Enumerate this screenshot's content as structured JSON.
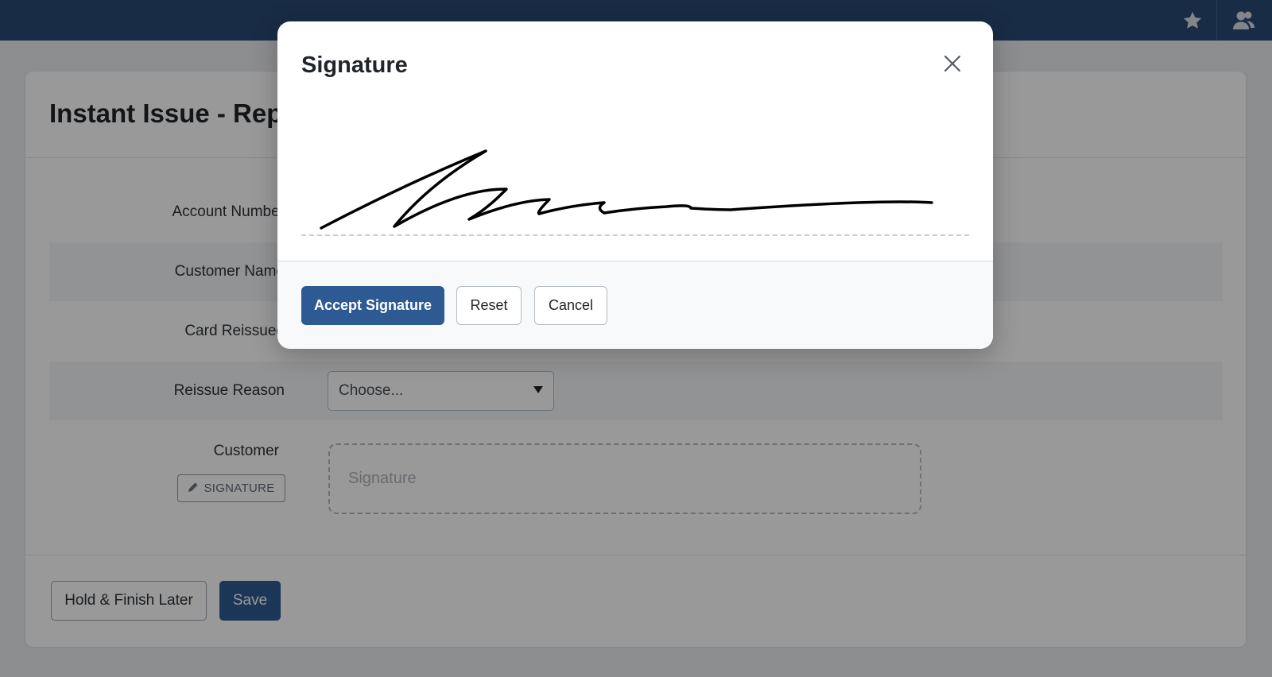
{
  "navbar": {
    "star_icon": "star-icon",
    "users_icon": "users-icon"
  },
  "page": {
    "title": "Instant Issue - Rep",
    "fields": [
      {
        "label": "Account Number"
      },
      {
        "label": "Customer Name"
      },
      {
        "label": "Card Reissued"
      },
      {
        "label": "Reissue Reason"
      }
    ],
    "reissue_reason_value": "Choose...",
    "customer_label": "Customer",
    "signature_button_label": "SIGNATURE",
    "signature_placeholder": "Signature",
    "hold_button_label": "Hold & Finish Later",
    "save_button_label": "Save"
  },
  "modal": {
    "title": "Signature",
    "accept_label": "Accept Signature",
    "reset_label": "Reset",
    "cancel_label": "Cancel"
  },
  "colors": {
    "navbar": "#2b4a73",
    "primary": "#2d5a92",
    "backdrop": "rgba(0,0,0,0.40)"
  }
}
